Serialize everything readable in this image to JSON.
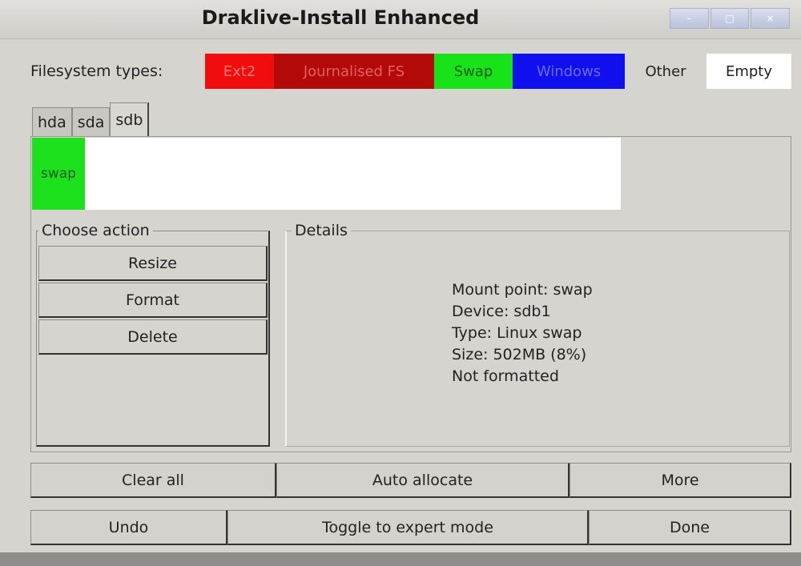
{
  "window": {
    "title": "Draklive-Install Enhanced",
    "controls": [
      "–",
      "□",
      "×"
    ]
  },
  "filesystem_types": {
    "label": "Filesystem types:",
    "items": [
      {
        "label": "Ext2",
        "bg": "#f20d0d",
        "fg": "#ff7b7b"
      },
      {
        "label": "Journalised FS",
        "bg": "#b30909",
        "fg": "#e06060"
      },
      {
        "label": "Swap",
        "bg": "#18e318",
        "fg": "#0f5b0f"
      },
      {
        "label": "Windows",
        "bg": "#1010ee",
        "fg": "#6b6bff"
      },
      {
        "label": "Other",
        "bg": "#d6d4cf",
        "fg": "#222222"
      },
      {
        "label": "Empty",
        "bg": "#ffffff",
        "fg": "#222222"
      }
    ]
  },
  "tabs": [
    "hda",
    "sda",
    "sdb"
  ],
  "active_tab": "sdb",
  "disk": {
    "partition_label": "swap",
    "partition_color": "#1ee11e"
  },
  "choose_action": {
    "legend": "Choose action",
    "buttons": [
      "Resize",
      "Format",
      "Delete"
    ]
  },
  "details": {
    "legend": "Details",
    "lines": [
      "Mount point: swap",
      "Device: sdb1",
      "Type: Linux swap",
      "Size: 502MB (8%)",
      "Not formatted"
    ]
  },
  "bottom_buttons": {
    "clear_all": "Clear all",
    "auto_allocate": "Auto allocate",
    "more": "More",
    "undo": "Undo",
    "toggle_expert": "Toggle to expert mode",
    "done": "Done"
  }
}
